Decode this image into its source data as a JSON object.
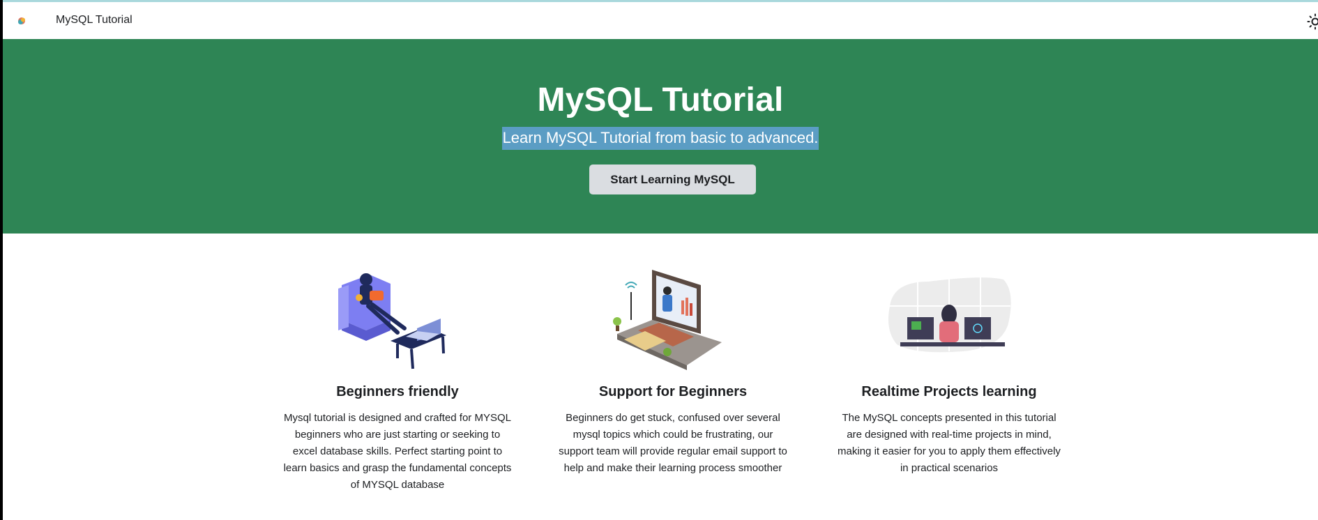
{
  "navbar": {
    "brand": "MySQL Tutorial",
    "logo_icon": "mysql-logo-icon",
    "theme_toggle_icon": "sun-icon"
  },
  "hero": {
    "title": "MySQL Tutorial",
    "subtitle": "Learn MySQL Tutorial from basic to advanced.",
    "button_label": "Start Learning MySQL",
    "background_color": "#2e8555",
    "selection_color": "#5b9dc4"
  },
  "features": [
    {
      "title": "Beginners friendly",
      "description": "Mysql tutorial is designed and crafted for MYSQL beginners who are just starting or seeking to excel database skills. Perfect starting point to learn basics and grasp the fundamental concepts of MYSQL database",
      "illustration": "person-on-couch-with-laptop-illustration"
    },
    {
      "title": "Support for Beginners",
      "description": "Beginners do get stuck, confused over several mysql topics which could be frustrating, our support team will provide regular email support to help and make their learning process smoother",
      "illustration": "online-teacher-laptop-illustration"
    },
    {
      "title": "Realtime Projects learning",
      "description": "The MySQL concepts presented in this tutorial are designed with real-time projects in mind, making it easier for you to apply them effectively in practical scenarios",
      "illustration": "developer-at-desk-illustration"
    }
  ]
}
